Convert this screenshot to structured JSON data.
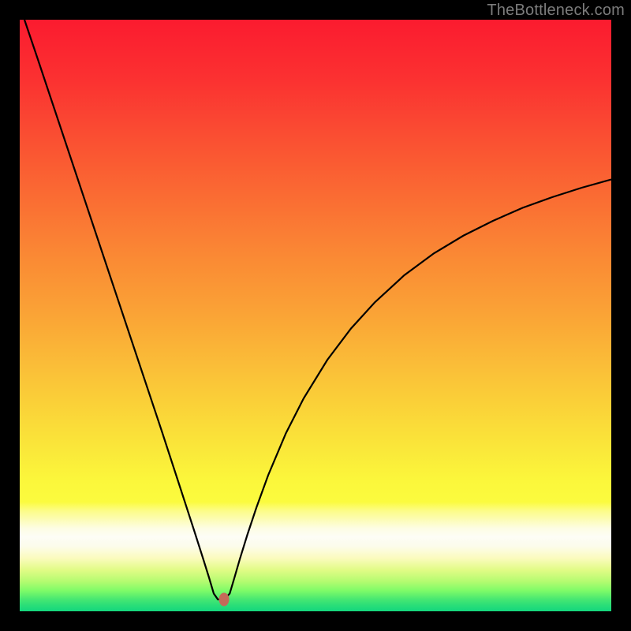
{
  "attribution": "TheBottleneck.com",
  "colors": {
    "frame": "#000000",
    "curve": "#000000",
    "marker": "#c56a59",
    "gradient_stops": [
      {
        "offset": 0.0,
        "color": "#fb1b2f"
      },
      {
        "offset": 0.1,
        "color": "#fb3131"
      },
      {
        "offset": 0.2,
        "color": "#fa4f32"
      },
      {
        "offset": 0.3,
        "color": "#fa6c33"
      },
      {
        "offset": 0.4,
        "color": "#fa8934"
      },
      {
        "offset": 0.5,
        "color": "#faa436"
      },
      {
        "offset": 0.6,
        "color": "#fac238"
      },
      {
        "offset": 0.7,
        "color": "#fae039"
      },
      {
        "offset": 0.78,
        "color": "#fbf73b"
      },
      {
        "offset": 0.815,
        "color": "#fbfb3e"
      },
      {
        "offset": 0.83,
        "color": "#fcfc87"
      },
      {
        "offset": 0.86,
        "color": "#fdfde4"
      },
      {
        "offset": 0.874,
        "color": "#fdfdf6"
      },
      {
        "offset": 0.89,
        "color": "#fcfceb"
      },
      {
        "offset": 0.91,
        "color": "#fbfbbe"
      },
      {
        "offset": 0.93,
        "color": "#e1fb86"
      },
      {
        "offset": 0.95,
        "color": "#b3fb70"
      },
      {
        "offset": 0.965,
        "color": "#7ffb68"
      },
      {
        "offset": 0.98,
        "color": "#46e772"
      },
      {
        "offset": 0.99,
        "color": "#2ade78"
      },
      {
        "offset": 1.0,
        "color": "#14d67d"
      }
    ]
  },
  "chart_data": {
    "type": "line",
    "title": "",
    "xlabel": "",
    "ylabel": "",
    "xlim": [
      0,
      100
    ],
    "ylim": [
      0,
      100
    ],
    "marker": {
      "x": 34.5,
      "y": 2.0
    },
    "series": [
      {
        "name": "bottleneck-curve",
        "x": [
          0.8,
          3,
          6,
          9,
          12,
          15,
          18,
          21,
          24,
          27,
          29.5,
          31,
          32,
          32.8,
          33.5,
          34.6,
          35.5,
          36.3,
          37.2,
          38.5,
          40,
          42,
          45,
          48,
          52,
          56,
          60,
          65,
          70,
          75,
          80,
          85,
          90,
          95,
          100
        ],
        "y": [
          100,
          93.5,
          84.5,
          75.5,
          66.5,
          57.5,
          48.5,
          39.5,
          30.5,
          21.3,
          13.6,
          8.9,
          5.7,
          3.0,
          2.0,
          2.0,
          3.0,
          5.7,
          8.8,
          13.0,
          17.5,
          23.0,
          30.1,
          36.0,
          42.5,
          47.8,
          52.2,
          56.8,
          60.5,
          63.5,
          66.0,
          68.2,
          70.0,
          71.6,
          73.0
        ]
      }
    ]
  }
}
